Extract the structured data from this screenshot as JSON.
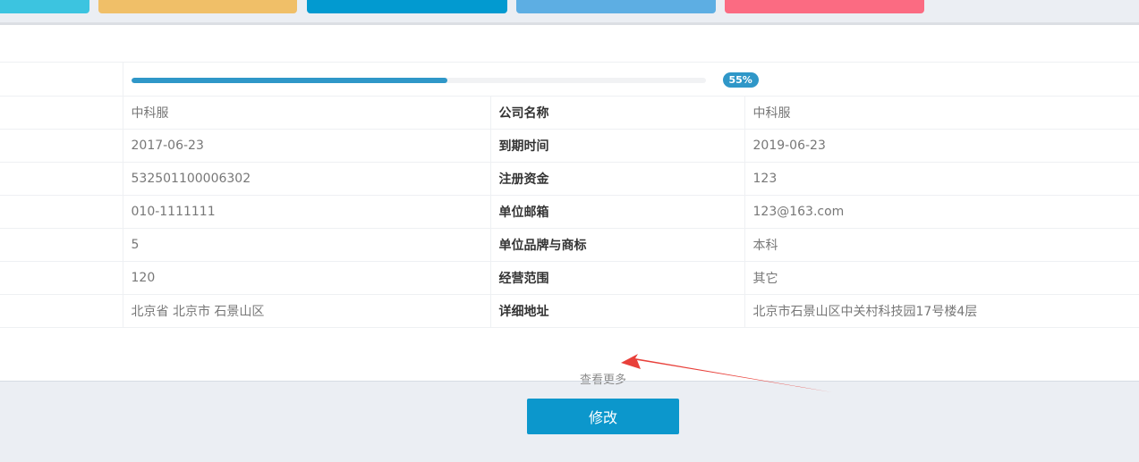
{
  "top_tabs": [
    {
      "name": "tab-cyan",
      "color": "#3cc4e0"
    },
    {
      "name": "tab-orange",
      "color": "#f0bf68"
    },
    {
      "name": "tab-blue",
      "color": "#029ad0"
    },
    {
      "name": "tab-lightblue",
      "color": "#5daee3"
    },
    {
      "name": "tab-pink",
      "color": "#fb6b82"
    }
  ],
  "progress": {
    "value": 0.55,
    "label": "55%",
    "color": "#2f97c8",
    "badge_color": "#2f97c8"
  },
  "rows": [
    {
      "left_value": "中科服",
      "right_label": "公司名称",
      "right_value": "中科服"
    },
    {
      "left_value": "2017-06-23",
      "right_label": "到期时间",
      "right_value": "2019-06-23"
    },
    {
      "left_value": "532501100006302",
      "right_label": "注册资金",
      "right_value": "123"
    },
    {
      "left_value": "010-1111111",
      "right_label": "单位邮箱",
      "right_value": "123@163.com"
    },
    {
      "left_value": "5",
      "right_label": "单位品牌与商标",
      "right_value": "本科"
    },
    {
      "left_value": "120",
      "right_label": "经营范围",
      "right_value": "其它"
    },
    {
      "left_value": "北京省 北京市 石景山区",
      "right_label": "详细地址",
      "right_value": "北京市石景山区中关村科技园17号楼4层"
    }
  ],
  "more_link": "查看更多",
  "edit_button": {
    "label": "修改",
    "color": "#0c97cc"
  },
  "annotation_arrow_color": "#e8403a"
}
